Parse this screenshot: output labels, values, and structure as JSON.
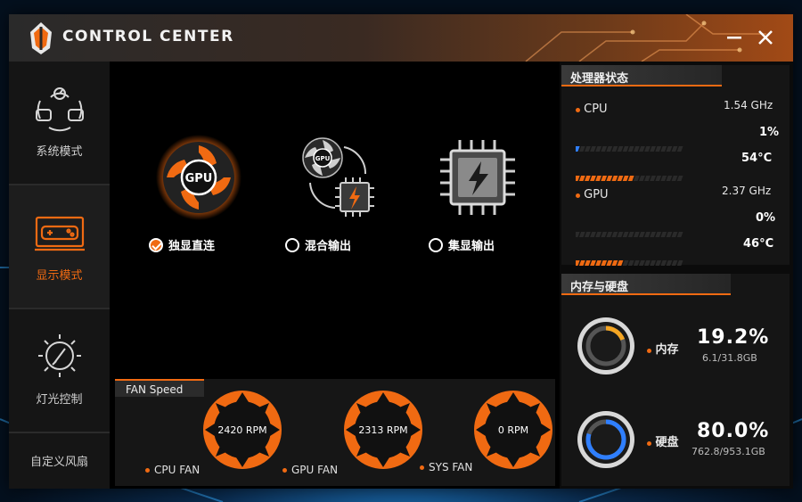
{
  "app": {
    "title": "CONTROL CENTER"
  },
  "sidebar": {
    "items": [
      {
        "label": "系统模式",
        "icon": "gamepad-speed-icon"
      },
      {
        "label": "显示模式",
        "icon": "display-gamepad-icon",
        "active": true
      },
      {
        "label": "灯光控制",
        "icon": "light-brush-icon"
      },
      {
        "label": "自定义风扇"
      }
    ]
  },
  "display_modes": [
    {
      "label": "独显直连",
      "icon": "gpu-fan-icon",
      "selected": true
    },
    {
      "label": "混合输出",
      "icon": "hybrid-gpu-chip-icon",
      "selected": false
    },
    {
      "label": "集显输出",
      "icon": "integrated-chip-icon",
      "selected": false
    }
  ],
  "gpu_icon_text": "GPU",
  "fan_speed": {
    "title": "FAN Speed",
    "fans": [
      {
        "name": "CPU FAN",
        "rpm": "2420 RPM"
      },
      {
        "name": "GPU FAN",
        "rpm": "2313 RPM"
      },
      {
        "name": "SYS FAN",
        "rpm": "0 RPM"
      }
    ]
  },
  "processor_status": {
    "title": "处理器状态",
    "cpu": {
      "name": "CPU",
      "freq": "1.54 GHz",
      "usage": "1%",
      "temp": "54°C",
      "usage_level": 0.01,
      "temp_level": 0.54
    },
    "gpu": {
      "name": "GPU",
      "freq": "2.37 GHz",
      "usage": "0%",
      "temp": "46°C",
      "usage_level": 0.0,
      "temp_level": 0.46
    }
  },
  "memory_disk": {
    "title": "内存与硬盘",
    "memory": {
      "label": "内存",
      "percent": "19.2%",
      "detail": "6.1/31.8GB",
      "level": 0.192
    },
    "disk": {
      "label": "硬盘",
      "percent": "80.0%",
      "detail": "762.8/953.1GB",
      "level": 0.8
    }
  },
  "colors": {
    "accent": "#f06a12",
    "memory_ring": "#f5a623",
    "disk_ring": "#2f7fff"
  }
}
